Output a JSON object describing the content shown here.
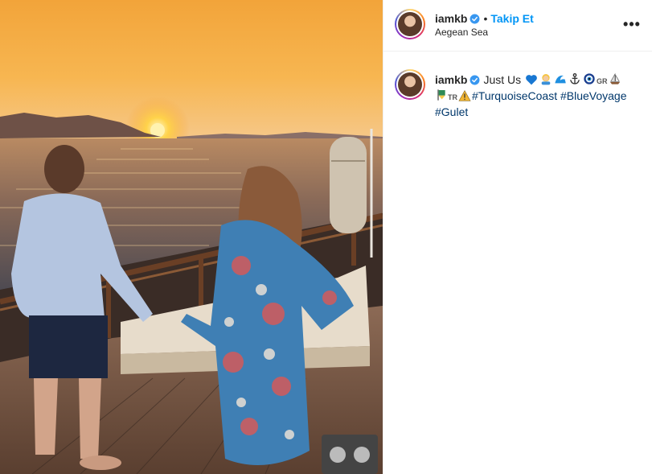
{
  "post": {
    "username": "iamkb",
    "follow_label": "Takip Et",
    "separator": "•",
    "location": "Aegean Sea",
    "more_icon": "more-horizontal-icon",
    "caption": {
      "text": "Just Us",
      "emojis": [
        "blue-heart",
        "person-blond-hair",
        "water-wave",
        "anchor",
        "nazar-amulet",
        "flag-greece",
        "sailboat",
        "flag-turkey",
        "warning-sign"
      ],
      "gr_label": "GR",
      "tr_label": "TR",
      "hashtags": [
        "#TurquoiseCoast",
        "#BlueVoyage",
        "#Gulet"
      ]
    }
  },
  "colors": {
    "accent": "#0095f6",
    "hashtag": "#00376b",
    "verified": "#3897f0",
    "text": "#262626"
  }
}
